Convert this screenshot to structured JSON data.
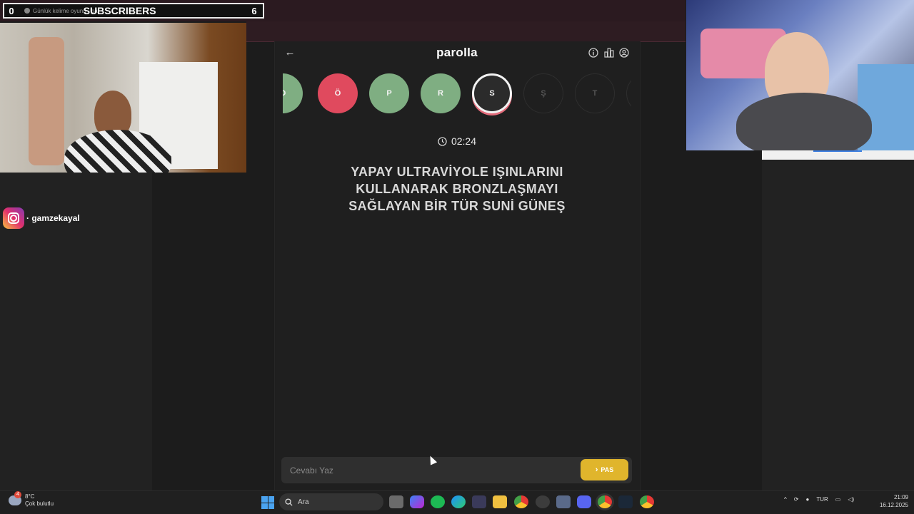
{
  "overlay": {
    "left_count": "0",
    "tab_title": "Günlük kelime oyunu - pa",
    "subscribers_label": "SUBSCRIBERS",
    "subscribers_count": "6"
  },
  "instagram": {
    "handle": "· gamzekayal"
  },
  "game": {
    "title": "parolla",
    "letters": [
      {
        "letter": "O",
        "state": "correct"
      },
      {
        "letter": "Ö",
        "state": "wrong"
      },
      {
        "letter": "P",
        "state": "correct"
      },
      {
        "letter": "R",
        "state": "correct"
      },
      {
        "letter": "S",
        "state": "active"
      },
      {
        "letter": "Ş",
        "state": "pending"
      },
      {
        "letter": "T",
        "state": "pending"
      }
    ],
    "timer": "02:24",
    "question_lines": [
      "YAPAY ULTRAVİYOLE IŞINLARINI",
      "KULLANARAK BRONZLAŞMAYI",
      "SAĞLAYAN BİR TÜR SUNİ GÜNEŞ"
    ],
    "answer_placeholder": "Cevabı Yaz",
    "pass_label": "PAS"
  },
  "taskbar": {
    "temperature": "8°C",
    "weather": "Çok bulutlu",
    "weather_badge": "4",
    "search_placeholder": "Ara",
    "language": "TUR",
    "time": "21:09",
    "date": "16.12.2025"
  },
  "colors": {
    "correct": "#7fae82",
    "wrong": "#e04a5e",
    "pass_button": "#e0b52c"
  }
}
